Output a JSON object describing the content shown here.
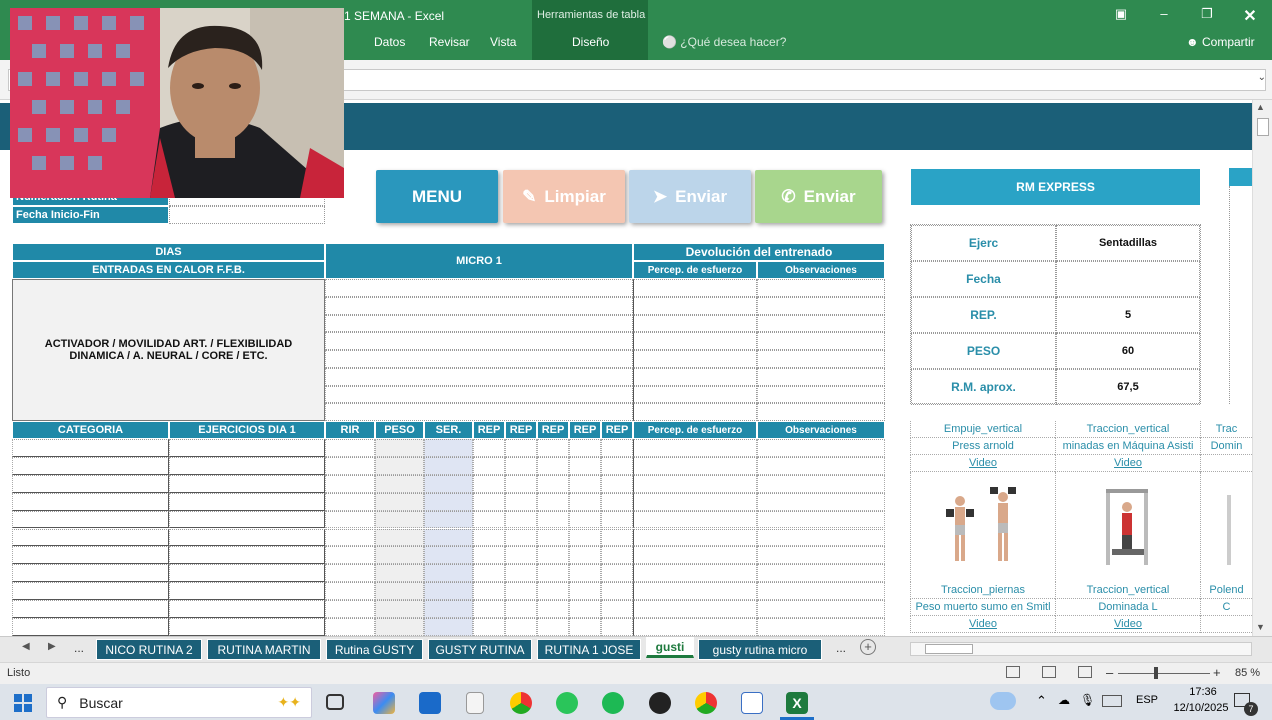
{
  "titlebar": {
    "title": "1 SEMANA - Excel",
    "context_group": "Herramientas de tabla",
    "tabs": [
      "Datos",
      "Revisar",
      "Vista",
      "Diseño"
    ],
    "search": "¿Qué desea hacer?",
    "share": "Compartir"
  },
  "sheet": {
    "info_labels": [
      "Numeración Rutina",
      "Fecha Inicio-Fin"
    ],
    "buttons": {
      "menu": "MENU",
      "clear": "Limpiar",
      "send1": "Enviar",
      "send2": "Enviar"
    },
    "table": {
      "dias": "DIAS",
      "warmup": "ENTRADAS EN CALOR F.F.B.",
      "micro": "MICRO 1",
      "devolucion": "Devolución del entrenado",
      "percep": "Percep. de esfuerzo",
      "obs": "Observaciones",
      "activator": "ACTIVADOR / MOVILIDAD ART. / FLEXIBILIDAD DINAMICA / A. NEURAL / CORE / ETC.",
      "cols": [
        "CATEGORIA",
        "EJERCICIOS DIA 1",
        "RIR",
        "PESO",
        "SER.",
        "REP",
        "REP",
        "REP",
        "REP",
        "REP",
        "Percep. de esfuerzo",
        "Observaciones"
      ]
    },
    "rm": {
      "title": "RM EXPRESS",
      "rows": [
        {
          "label": "Ejerc",
          "value": "Sentadillas"
        },
        {
          "label": "Fecha",
          "value": ""
        },
        {
          "label": "REP.",
          "value": "5"
        },
        {
          "label": "PESO",
          "value": "60"
        },
        {
          "label": "R.M. aprox.",
          "value": "67,5"
        }
      ]
    },
    "exercises": [
      {
        "cat": "Empuje_vertical",
        "name": "Press arnold",
        "video": "Video"
      },
      {
        "cat": "Traccion_vertical",
        "name": "minadas en Máquina Asisti",
        "video": "Video"
      },
      {
        "cat": "Trac",
        "name": "Domin",
        "video": ""
      },
      {
        "cat": "Traccion_piernas",
        "name": "Peso muerto sumo en Smitl",
        "video": "Video"
      },
      {
        "cat": "Traccion_vertical",
        "name": "Dominada L",
        "video": "Video"
      },
      {
        "cat": "Polend",
        "name": "C",
        "video": ""
      }
    ]
  },
  "sheet_tabs": [
    "NICO RUTINA 2",
    "RUTINA MARTIN",
    "Rutina GUSTY",
    "GUSTY RUTINA",
    "RUTINA 1 JOSE",
    "gusti",
    "gusty rutina micro"
  ],
  "sheet_tabs_more": "...",
  "status": {
    "ready": "Listo",
    "zoom": "85 %"
  },
  "taskbar": {
    "search": "Buscar",
    "lang": "ESP",
    "time": "17:36",
    "date": "12/10/2025",
    "notif_count": "7"
  }
}
